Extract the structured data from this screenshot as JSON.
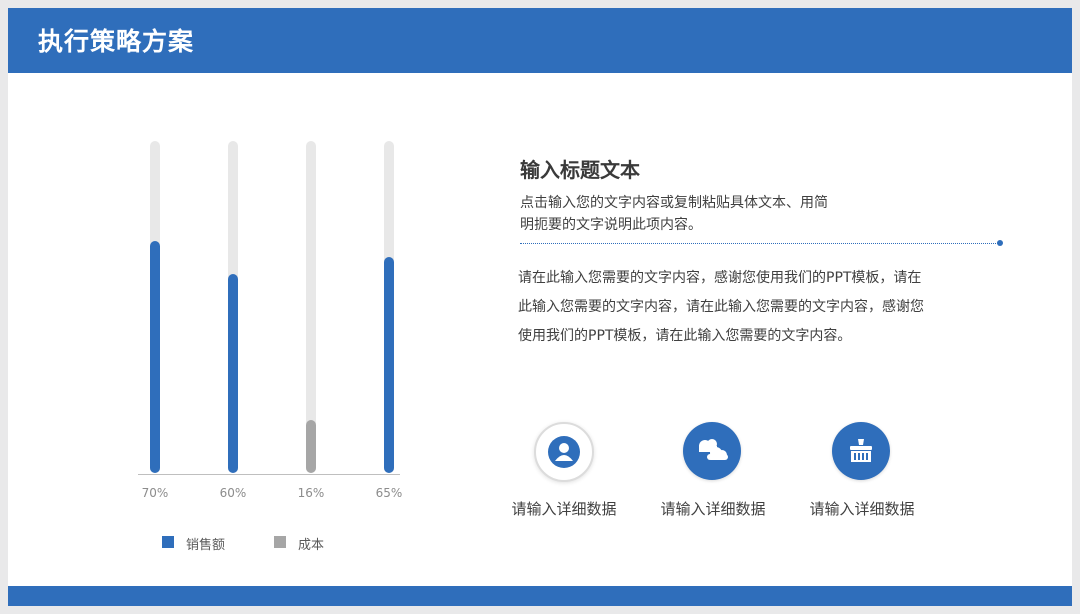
{
  "header": {
    "title": "执行策略方案"
  },
  "colors": {
    "accent": "#2f6ebb",
    "cost": "#a6a6a6",
    "track": "#e8e8e8"
  },
  "chart_data": {
    "type": "bar",
    "categories": [
      "70%",
      "60%",
      "16%",
      "65%"
    ],
    "values": [
      70,
      60,
      16,
      65
    ],
    "bar_series": [
      "销售额",
      "销售额",
      "成本",
      "销售额"
    ],
    "ylim": [
      0,
      100
    ],
    "series": [
      {
        "name": "销售额",
        "color": "#2f6ebb"
      },
      {
        "name": "成本",
        "color": "#a6a6a6"
      }
    ],
    "legend_position": "bottom"
  },
  "content": {
    "heading": "输入标题文本",
    "subtext_line1": "点击输入您的文字内容或复制粘贴具体文本、用简",
    "subtext_line2": "明扼要的文字说明此项内容。",
    "body_line1": "请在此输入您需要的文字内容，感谢您使用我们的PPT模板，请在",
    "body_line2": "此输入您需要的文字内容，请在此输入您需要的文字内容，感谢您",
    "body_line3": "使用我们的PPT模板，请在此输入您需要的文字内容。"
  },
  "features": [
    {
      "icon": "user-icon",
      "label": "请输入详细数据"
    },
    {
      "icon": "cloud-icon",
      "label": "请输入详细数据"
    },
    {
      "icon": "brush-icon",
      "label": "请输入详细数据"
    }
  ]
}
